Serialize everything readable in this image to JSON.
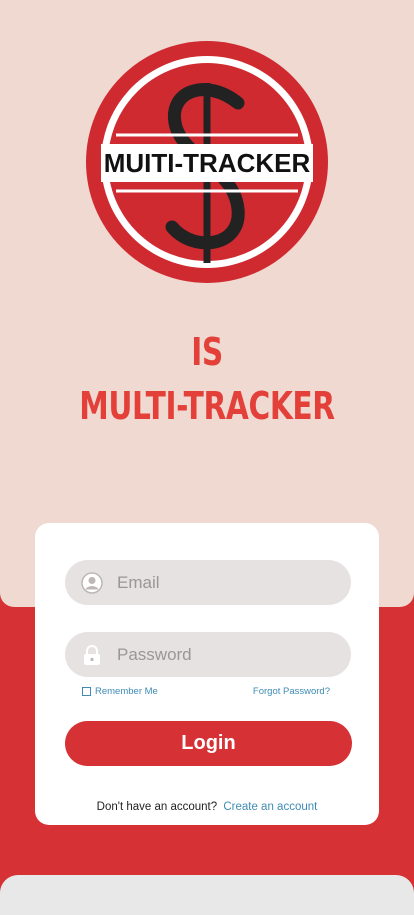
{
  "logo": {
    "text": "MUITI-TRACKER"
  },
  "headline": {
    "line1": "IS",
    "line2": "MULTI-TRACKER"
  },
  "login_form": {
    "email_placeholder": "Email",
    "password_placeholder": "Password",
    "remember_label": "Remember Me",
    "forgot_label": "Forgot Password?",
    "login_label": "Login",
    "no_account_text": "Don't have an account?",
    "create_account_label": "Create an account"
  },
  "icons": {
    "email": "user-avatar-icon",
    "password": "padlock-icon",
    "logo": "dollar-sign-icon"
  },
  "colors": {
    "accent": "#d63134",
    "headline": "#e3403a",
    "background": "#efd9d0",
    "link": "#3f8bb5"
  }
}
